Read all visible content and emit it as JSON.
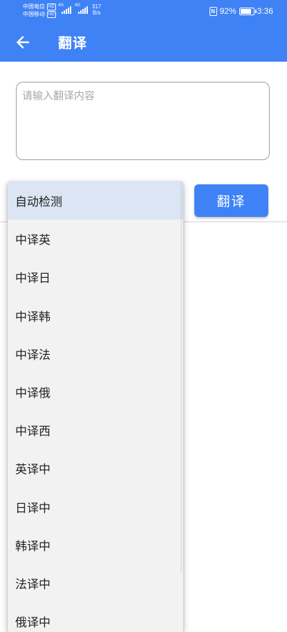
{
  "status_bar": {
    "carrier1": "中国电信",
    "carrier2": "中国移动",
    "hd_badge": "HD",
    "network1": "4G",
    "network2": "4G",
    "speed_value": "317",
    "speed_unit": "B/s",
    "nfc_icon": "N",
    "battery_text": "92%",
    "battery_level": 0.92,
    "time": "3:36"
  },
  "app_bar": {
    "title": "翻译",
    "background": "#3f82f5",
    "back_icon": "arrow-left-icon"
  },
  "input": {
    "value": "",
    "placeholder": "请输入翻译内容"
  },
  "translate_button": {
    "label": "翻译"
  },
  "language_dropdown": {
    "selected_index": 0,
    "selected_background": "#dbe5f3",
    "items": [
      {
        "label": "自动检测"
      },
      {
        "label": "中译英"
      },
      {
        "label": "中译日"
      },
      {
        "label": "中译韩"
      },
      {
        "label": "中译法"
      },
      {
        "label": "中译俄"
      },
      {
        "label": "中译西"
      },
      {
        "label": "英译中"
      },
      {
        "label": "日译中"
      },
      {
        "label": "韩译中"
      },
      {
        "label": "法译中"
      },
      {
        "label": "俄译中"
      }
    ]
  }
}
